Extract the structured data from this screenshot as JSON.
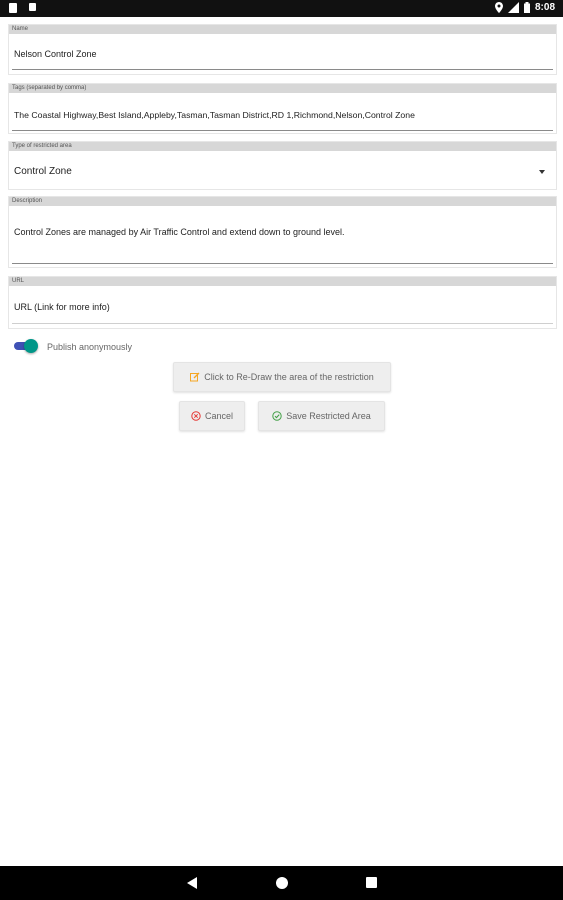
{
  "status_bar": {
    "time": "8:08",
    "icons": [
      "sim-icon",
      "notification-icon",
      "location-icon",
      "signal-icon",
      "battery-icon"
    ]
  },
  "form": {
    "name": {
      "label": "Name",
      "value": "Nelson Control Zone"
    },
    "tags": {
      "label": "Tags (separated by comma)",
      "value": "The Coastal Highway,Best Island,Appleby,Tasman,Tasman District,RD 1,Richmond,Nelson,Control Zone"
    },
    "type": {
      "label": "Type of restricted area",
      "value": "Control Zone"
    },
    "description": {
      "label": "Description",
      "value": "Control Zones are managed by Air Traffic Control and extend down to ground level."
    },
    "url": {
      "label": "URL",
      "placeholder": "URL (Link for more info)"
    },
    "publish": {
      "label": "Publish anonymously",
      "checked": true
    }
  },
  "buttons": {
    "redraw": "Click to Re-Draw the area of the restriction",
    "cancel": "Cancel",
    "save": "Save Restricted Area"
  },
  "colors": {
    "toggle_track": "#3F51B5",
    "toggle_thumb": "#009688",
    "redraw_icon": "#F5A623",
    "cancel_icon": "#E53935",
    "save_icon": "#43A047"
  }
}
